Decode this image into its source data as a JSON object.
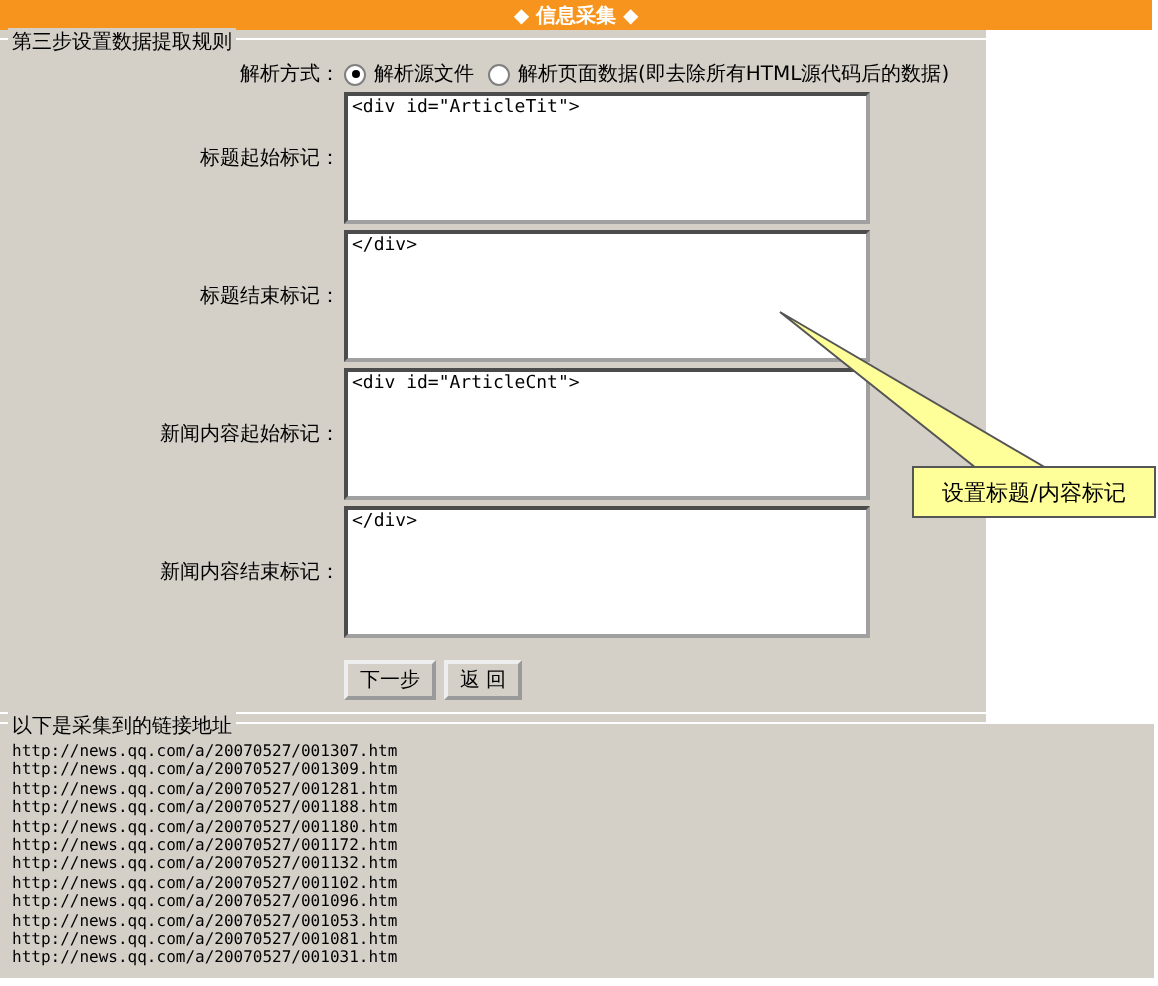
{
  "header": {
    "title": "◆ 信息采集 ◆"
  },
  "rules": {
    "legend": "第三步设置数据提取规则",
    "parse_mode": {
      "label": "解析方式：",
      "options": [
        {
          "label": "解析源文件",
          "selected": true
        },
        {
          "label": "解析页面数据(即去除所有HTML源代码后的数据)",
          "selected": false
        }
      ]
    },
    "fields": [
      {
        "label": "标题起始标记：",
        "value": "<div id=\"ArticleTit\">"
      },
      {
        "label": "标题结束标记：",
        "value": "</div>"
      },
      {
        "label": "新闻内容起始标记：",
        "value": "<div id=\"ArticleCnt\">"
      },
      {
        "label": "新闻内容结束标记：",
        "value": "</div>"
      }
    ],
    "buttons": [
      "下一步",
      "返 回"
    ]
  },
  "links": {
    "legend": "以下是采集到的链接地址",
    "items": [
      "http://news.qq.com/a/20070527/001307.htm",
      "http://news.qq.com/a/20070527/001309.htm",
      "http://news.qq.com/a/20070527/001281.htm",
      "http://news.qq.com/a/20070527/001188.htm",
      "http://news.qq.com/a/20070527/001180.htm",
      "http://news.qq.com/a/20070527/001172.htm",
      "http://news.qq.com/a/20070527/001132.htm",
      "http://news.qq.com/a/20070527/001102.htm",
      "http://news.qq.com/a/20070527/001096.htm",
      "http://news.qq.com/a/20070527/001053.htm",
      "http://news.qq.com/a/20070527/001081.htm",
      "http://news.qq.com/a/20070527/001031.htm"
    ]
  },
  "callout": {
    "text": "设置标题/内容标记"
  }
}
